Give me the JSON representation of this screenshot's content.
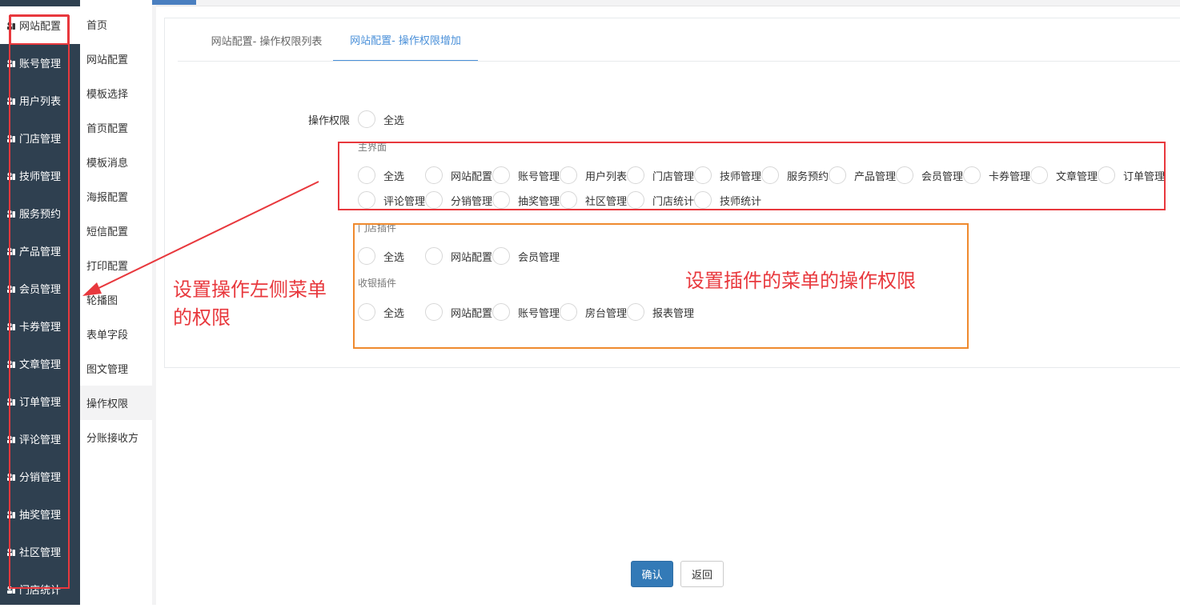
{
  "sidebar": {
    "items": [
      {
        "label": "网站配置",
        "icon": "monitor-icon"
      },
      {
        "label": "账号管理",
        "icon": "users-icon"
      },
      {
        "label": "用户列表",
        "icon": "user-list-icon"
      },
      {
        "label": "门店管理",
        "icon": "store-icon"
      },
      {
        "label": "技师管理",
        "icon": "technician-icon"
      },
      {
        "label": "服务预约",
        "icon": "calendar-icon"
      },
      {
        "label": "产品管理",
        "icon": "product-icon"
      },
      {
        "label": "会员管理",
        "icon": "member-icon"
      },
      {
        "label": "卡券管理",
        "icon": "coupon-icon"
      },
      {
        "label": "文章管理",
        "icon": "article-icon"
      },
      {
        "label": "订单管理",
        "icon": "order-icon"
      },
      {
        "label": "评论管理",
        "icon": "comment-icon"
      },
      {
        "label": "分销管理",
        "icon": "distribution-icon"
      },
      {
        "label": "抽奖管理",
        "icon": "lottery-icon"
      },
      {
        "label": "社区管理",
        "icon": "community-icon"
      },
      {
        "label": "门店统计",
        "icon": "stats-icon"
      }
    ]
  },
  "subnav": {
    "items": [
      "首页",
      "网站配置",
      "模板选择",
      "首页配置",
      "模板消息",
      "海报配置",
      "短信配置",
      "打印配置",
      "轮播图",
      "表单字段",
      "图文管理",
      "操作权限",
      "分账接收方"
    ]
  },
  "tabs": [
    "网站配置- 操作权限列表",
    "网站配置- 操作权限增加"
  ],
  "form": {
    "permission_label": "操作权限",
    "select_all": "全选",
    "groups": [
      {
        "title": "主界面",
        "options": [
          "全选",
          "网站配置",
          "账号管理",
          "用户列表",
          "门店管理",
          "技师管理",
          "服务预约",
          "产品管理",
          "会员管理",
          "卡券管理",
          "文章管理",
          "订单管理",
          "评论管理",
          "分销管理",
          "抽奖管理",
          "社区管理",
          "门店统计",
          "技师统计"
        ]
      },
      {
        "title": "门店插件",
        "options": [
          "全选",
          "网站配置",
          "会员管理"
        ]
      },
      {
        "title": "收银插件",
        "options": [
          "全选",
          "网站配置",
          "账号管理",
          "房台管理",
          "报表管理"
        ]
      }
    ]
  },
  "annotations": {
    "left_note_line1": "设置操作左侧菜单",
    "left_note_line2": "的权限",
    "plugin_note": "设置插件的菜单的操作权限",
    "red_color": "#e8383d",
    "orange_color": "#ef8a2e"
  },
  "buttons": {
    "confirm": "确认",
    "back": "返回"
  },
  "colors": {
    "sidebar_bg": "#2f4050",
    "accent": "#4a90d9",
    "primary_button": "#337ab7"
  }
}
